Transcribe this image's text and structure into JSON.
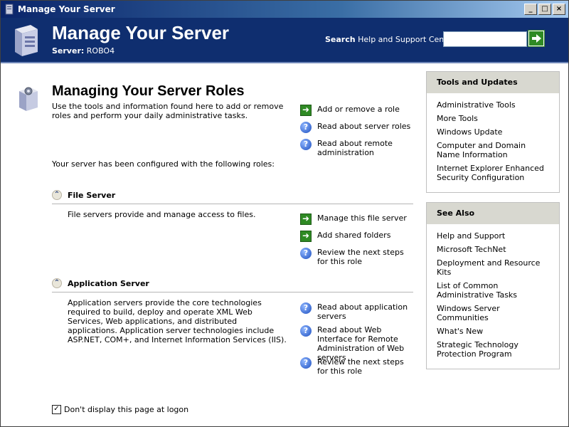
{
  "window": {
    "title": "Manage Your Server",
    "buttons": [
      "_",
      "□",
      "×"
    ]
  },
  "header": {
    "title": "Manage Your Server",
    "server_label": "Server:",
    "server_name": "ROBO4",
    "search_label": "Search",
    "search_scope": "Help and Support Center",
    "search_value": "",
    "go_icon": "go-arrow-icon"
  },
  "main": {
    "title": "Managing Your Server Roles",
    "description": "Use the tools and information found here to add or remove roles and perform your daily administrative tasks.",
    "configured_text": "Your server has been configured with the following roles:",
    "top_actions": [
      {
        "icon": "arrow",
        "label": "Add or remove a role"
      },
      {
        "icon": "help",
        "label": "Read about server roles"
      },
      {
        "icon": "help",
        "label": "Read about remote administration"
      }
    ],
    "roles": [
      {
        "title": "File Server",
        "description": "File servers provide and manage access to files.",
        "actions": [
          {
            "icon": "arrow",
            "label": "Manage this file server"
          },
          {
            "icon": "arrow",
            "label": "Add shared folders"
          },
          {
            "icon": "help",
            "label": "Review the next steps for this role"
          }
        ]
      },
      {
        "title": "Application Server",
        "description": "Application servers provide the core technologies required to build, deploy and operate XML Web Services, Web applications, and distributed applications. Application server technologies include ASP.NET, COM+, and Internet Information Services (IIS).",
        "actions": [
          {
            "icon": "help",
            "label": "Read about application servers"
          },
          {
            "icon": "help",
            "label": "Read about Web Interface for Remote Administration of Web servers"
          },
          {
            "icon": "help",
            "label": "Review the next steps for this role"
          }
        ]
      }
    ],
    "dont_display": {
      "label": "Don't display this page at logon",
      "checked": true
    }
  },
  "sidebar": {
    "tools": {
      "title": "Tools and Updates",
      "links": [
        "Administrative Tools",
        "More Tools",
        "Windows Update",
        "Computer and Domain Name Information",
        "Internet Explorer Enhanced Security Configuration"
      ]
    },
    "see_also": {
      "title": "See Also",
      "links": [
        "Help and Support",
        "Microsoft TechNet",
        "Deployment and Resource Kits",
        "List of Common Administrative Tasks",
        "Windows Server Communities",
        "What's New",
        "Strategic Technology Protection Program"
      ]
    }
  },
  "colors": {
    "header_bg": "#0f2e6f",
    "panel_head": "#d8d8d0",
    "go_green": "#2f8a24"
  }
}
